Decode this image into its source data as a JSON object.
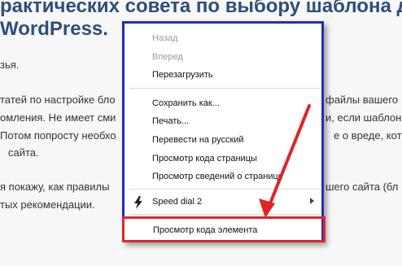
{
  "article": {
    "title_line1": "рактических совета по выбору шаблона д",
    "title_line2": "WordPress.",
    "para1": "зья.",
    "p2_left": "татей по настройке бло",
    "p2_right": "файлы вашего",
    "p3_left": "омления. Не имеет сми",
    "p3_right": "и, если шаблон",
    "p4_left": "Потом попросту необхо",
    "p4_right": "е о вреде, кот",
    "p5": "сайта.",
    "p6_left": "я покажу, как правилы",
    "p6_right": "шего сайта (бл",
    "p7": "тых рекомендации."
  },
  "menu": {
    "back": "Назад",
    "forward": "Вперед",
    "reload": "Перезагрузить",
    "save_as": "Сохранить как...",
    "print": "Печать...",
    "translate": "Перевести на русский",
    "view_source": "Просмотр кода страницы",
    "page_info": "Просмотр  сведений о странице",
    "speed_dial": "Speed dial 2",
    "inspect": "Просмотр кода элемента"
  },
  "colors": {
    "menu_border": "#1f2fbf",
    "highlight": "#e0242a",
    "title": "#2d4f7a"
  }
}
